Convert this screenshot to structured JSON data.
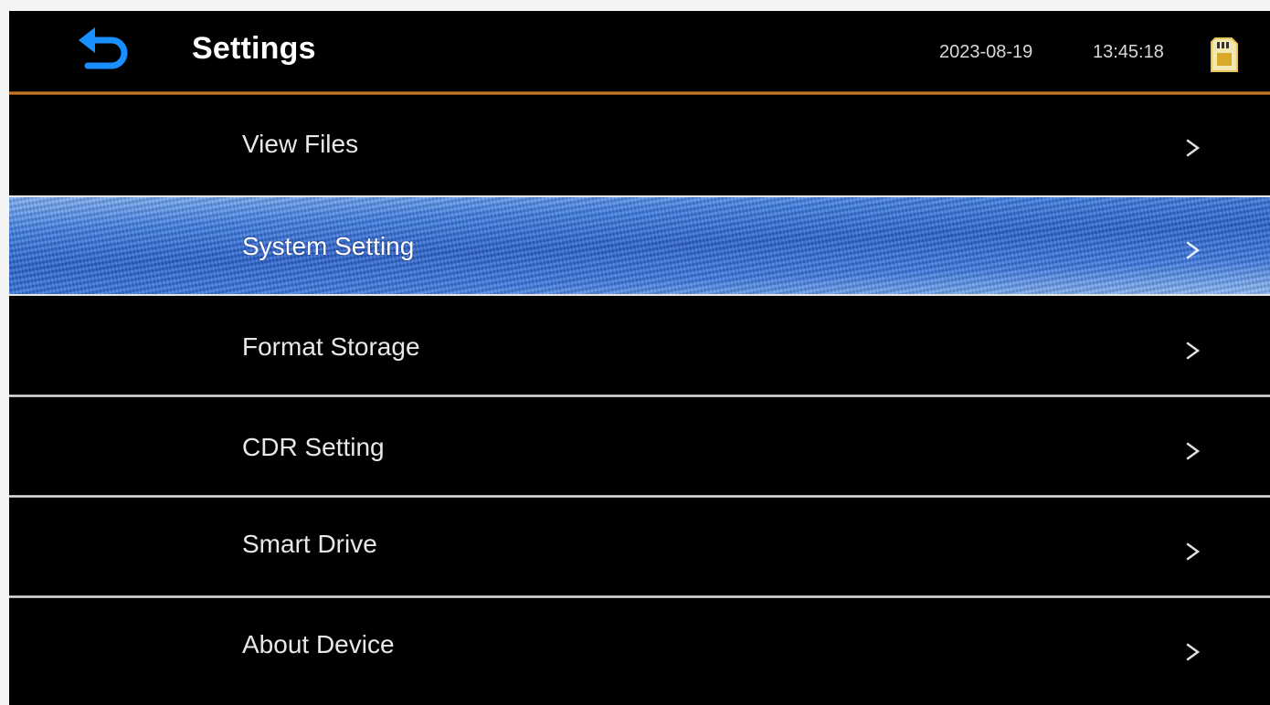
{
  "header": {
    "title": "Settings",
    "date": "2023-08-19",
    "time": "13:45:18",
    "back_icon": "back-arrow-icon",
    "storage_icon": "sd-card-icon",
    "accent_color": "#e08a2e",
    "back_icon_color": "#1a8fff"
  },
  "menu": {
    "selected_index": 1,
    "selected_color": "#2a63d0",
    "chevron_icon": "chevron-right-icon",
    "items": [
      {
        "label": "View Files",
        "chevron": ">"
      },
      {
        "label": "System Setting",
        "chevron": ">"
      },
      {
        "label": "Format Storage",
        "chevron": ">"
      },
      {
        "label": "CDR Setting",
        "chevron": ">"
      },
      {
        "label": "Smart Drive",
        "chevron": ">"
      },
      {
        "label": "About Device",
        "chevron": ">"
      }
    ]
  }
}
